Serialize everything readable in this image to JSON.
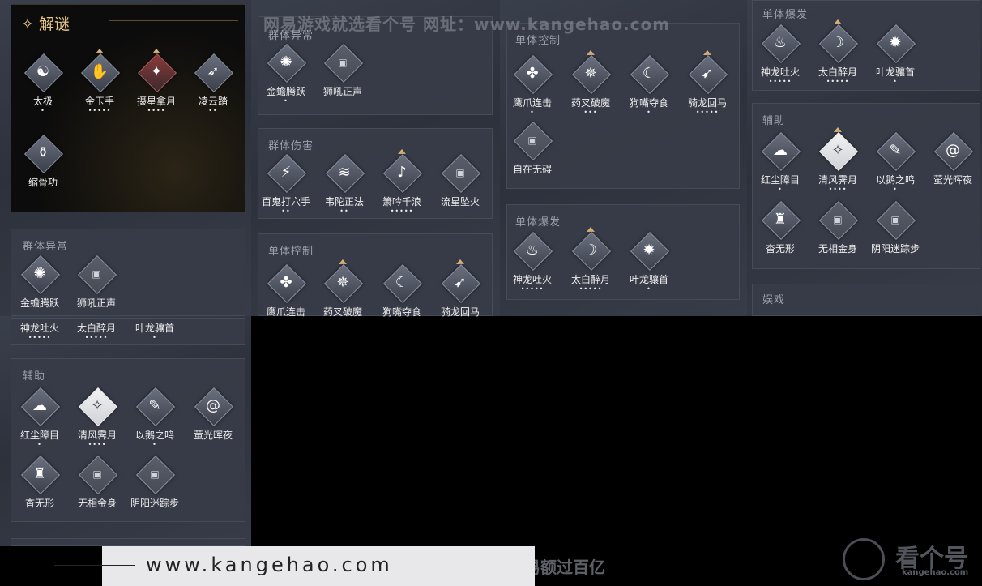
{
  "header": {
    "title": "✧ 解谜"
  },
  "watermarks": {
    "top": "网易游戏就选看个号  网址：www.kangehao.com",
    "bottom_url": "www.kangehao.com",
    "bottom_slogan": "看个号专业网易游戏八年  年交易额过百亿",
    "logo_text": "看个号",
    "logo_url": "kangehao.com"
  },
  "panel_titles": {
    "group_status": "群体异常",
    "group_damage": "群体伤害",
    "single_control": "单体控制",
    "single_burst": "单体爆发",
    "support": "辅助",
    "play": "娱戏"
  },
  "puzzle": [
    {
      "name": "太极",
      "dots": "•"
    },
    {
      "name": "金玉手",
      "dots": "•••••"
    },
    {
      "name": "摄星拿月",
      "dots": "••••"
    },
    {
      "name": "凌云踏",
      "dots": "••"
    },
    {
      "name": "缩骨功",
      "dots": ""
    }
  ],
  "group_status": [
    {
      "name": "金蟾腾跃",
      "dots": "•"
    },
    {
      "name": "狮吼正声",
      "dots": ""
    }
  ],
  "group_damage": [
    {
      "name": "百鬼打穴手",
      "dots": "••"
    },
    {
      "name": "韦陀正法",
      "dots": "••"
    },
    {
      "name": "箫吟千浪",
      "dots": "•••••"
    },
    {
      "name": "流星坠火",
      "dots": ""
    }
  ],
  "single_control": [
    {
      "name": "鹰爪连击",
      "dots": "•"
    },
    {
      "name": "药叉破魔",
      "dots": "•••"
    },
    {
      "name": "狗嘴夺食",
      "dots": "•"
    },
    {
      "name": "骑龙回马",
      "dots": "•••••"
    },
    {
      "name": "自在无碍",
      "dots": ""
    }
  ],
  "single_burst": [
    {
      "name": "神龙吐火",
      "dots": "•••••"
    },
    {
      "name": "太白醉月",
      "dots": "•••••"
    },
    {
      "name": "叶龙骧首",
      "dots": "•"
    }
  ],
  "support": [
    {
      "name": "红尘障目",
      "dots": "•"
    },
    {
      "name": "清风霁月",
      "dots": "••••"
    },
    {
      "name": "以鹅之鸣",
      "dots": "•"
    },
    {
      "name": "萤光晖夜",
      "dots": ""
    },
    {
      "name": "杳无形",
      "dots": ""
    },
    {
      "name": "无相金身",
      "dots": ""
    },
    {
      "name": "阴阳迷踪步",
      "dots": ""
    }
  ],
  "icons": {
    "active": "skill-icon",
    "locked": "locked-skill-icon"
  }
}
